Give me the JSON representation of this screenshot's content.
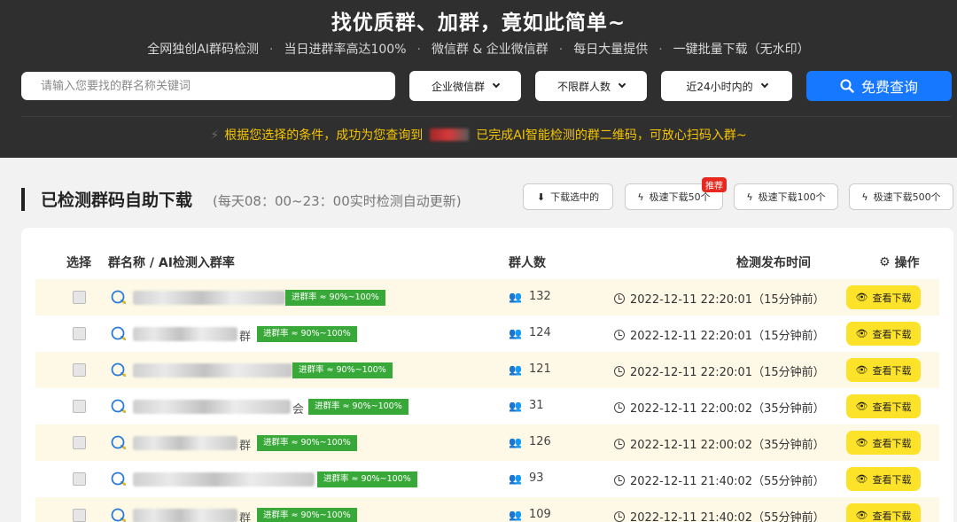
{
  "hero": {
    "title": "找优质群、加群，竟如此简单~",
    "features": [
      "全网独创AI群码检测",
      "当日进群率高达100%",
      "微信群 & 企业微信群",
      "每日大量提供",
      "一键批量下载（无水印）"
    ],
    "separator": "·",
    "search_placeholder": "请输入您要找的群名称关键词",
    "filters": {
      "group_type": "企业微信群",
      "member_count": "不限群人数",
      "time_range": "近24小时内的"
    },
    "query_button": "免费查询",
    "result_prefix": "根据您选择的条件，成功为您查询到",
    "result_suffix": "已完成AI智能检测的群二维码，可放心扫码入群~"
  },
  "section": {
    "title": "已检测群码自助下载",
    "note": "(每天08：00~23：00实时检测自动更新)",
    "buttons": [
      "下载选中的",
      "极速下载50个",
      "极速下载100个",
      "极速下载500个"
    ],
    "badge": "推荐"
  },
  "table": {
    "headers": {
      "select": "选择",
      "name": "群名称 / AI检测入群率",
      "count": "群人数",
      "time": "检测发布时间",
      "op": "操作"
    },
    "rows": [
      {
        "suffix": "",
        "rate": "进群率 ≈ 90%~100%",
        "count": "132",
        "time": "2022-12-11 22:20:01（15分钟前）",
        "action": "查看下载"
      },
      {
        "suffix": "群",
        "rate": "进群率 ≈ 90%~100%",
        "count": "124",
        "time": "2022-12-11 22:20:01（15分钟前）",
        "action": "查看下载"
      },
      {
        "suffix": "",
        "rate": "进群率 ≈ 90%~100%",
        "count": "121",
        "time": "2022-12-11 22:20:01（15分钟前）",
        "action": "查看下载"
      },
      {
        "suffix": "会",
        "rate": "进群率 ≈ 90%~100%",
        "count": "31",
        "time": "2022-12-11 22:00:02（35分钟前）",
        "action": "查看下载"
      },
      {
        "suffix": "群",
        "rate": "进群率 ≈ 90%~100%",
        "count": "126",
        "time": "2022-12-11 22:00:02（35分钟前）",
        "action": "查看下载"
      },
      {
        "suffix": "",
        "rate": "进群率 ≈ 90%~100%",
        "count": "93",
        "time": "2022-12-11 21:40:02（55分钟前）",
        "action": "查看下载"
      },
      {
        "suffix": "群",
        "rate": "进群率 ≈ 90%~100%",
        "count": "109",
        "time": "2022-12-11 21:40:02（55分钟前）",
        "action": "查看下载"
      }
    ]
  },
  "colors": {
    "accent_blue": "#1677ff",
    "highlight_yellow": "#f5c400",
    "rate_green": "#38a838",
    "view_yellow": "#fde22a",
    "row_alt": "#fdf9e6"
  }
}
